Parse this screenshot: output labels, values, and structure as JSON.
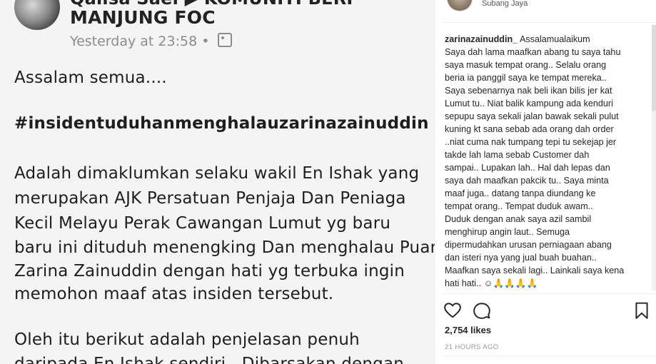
{
  "post_image": {
    "author_name": "Qalisa Saei ▶ KOMUNITI BERI",
    "group_name": "MANJUNG FOC",
    "timestamp": "Yesterday at 23:58 •",
    "meta_icon": "photo-audience-icon",
    "body_lines": [
      "Assalam semua....",
      "#insidentuduhanmenghalauzarinazainuddin",
      "Adalah dimaklumkan selaku wakil En Ishak yang",
      "merupakan AJK Persatuan Penjaja Dan Peniaga",
      "Kecil Melayu Perak Cawangan Lumut yg baru",
      "baru ini dituduh menengking Dan menghalau Puan",
      "Zarina Zainuddin dengan hati yg terbuka ingin",
      "memohon maaf atas insiden tersebut.",
      "Oleh itu berikut adalah penjelasan penuh",
      "daripada En Ishak sendiri.. Dibarsakan dengan"
    ]
  },
  "header": {
    "location": "Subang Jaya"
  },
  "caption": {
    "username": "zarinazainuddin_",
    "first_line_text": " Assalamualaikum",
    "lines": [
      "Saya dah lama maafkan abang tu saya tahu",
      "saya masuk tempat orang.. Selalu orang",
      "beria ia panggil saya ke tempat mereka..",
      "Saya sebenarnya nak beli ikan bilis jer kat",
      "Lumut tu.. Niat balik kampung ada kenduri",
      "sepupu saya sekali jalan bawak sekali pulut",
      "kuning kt sana sebab ada orang dah order",
      "..niat cuma nak tumpang tepi tu sekejap jer",
      "takde lah lama sebab Customer dah",
      "sampai.. Lupakan lah.. Hal dah lepas dan",
      "saya dah maafkan pakcik tu.. Saya minta",
      "maaf juga.. datang tanpa diundang ke",
      "tempat orang.. Tempat duduk awam..",
      "Duduk dengan anak saya azil sambil",
      "menghirup angin laut.. Semuga",
      "dipermudahkan urusan perniagaan abang",
      "dan isteri nya yang jual buah buahan..",
      "Maafkan saya sekali lagi.. Lainkali saya kena",
      "hati hati.. ☺🙏🙏🙏🙏"
    ]
  },
  "actions": {
    "like_icon": "heart-icon",
    "comment_icon": "comment-icon",
    "save_icon": "bookmark-icon"
  },
  "likes": "2,754 likes",
  "time_ago": "21 HOURS AGO",
  "colors": {
    "text": "#262626",
    "muted": "#999999",
    "divider": "#efefef"
  }
}
